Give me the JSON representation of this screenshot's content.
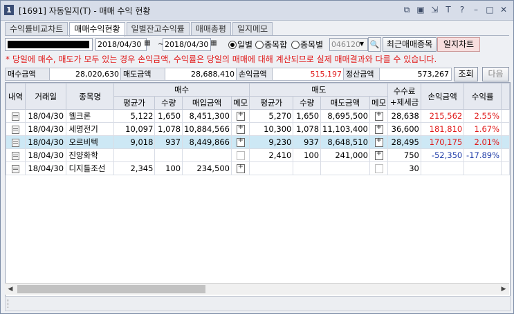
{
  "window": {
    "number": "1",
    "title": "[1691] 자동일지(T) - 매매 수익 현황"
  },
  "toolbar_icons": [
    "window-restore-icon",
    "window-split-icon",
    "arrow-icon",
    "font-icon",
    "help-icon",
    "minimize-icon",
    "maximize-icon",
    "close-icon"
  ],
  "tabs": [
    {
      "label": "수익률비교차트",
      "active": false
    },
    {
      "label": "매매수익현황",
      "active": true
    },
    {
      "label": "일별잔고수익률",
      "active": false
    },
    {
      "label": "매매총평",
      "active": false
    },
    {
      "label": "일지메모",
      "active": false
    }
  ],
  "filter": {
    "date_from": "2018/04/30",
    "date_to": "2018/04/30",
    "tilde": "~",
    "radios": [
      {
        "label": "일별",
        "selected": true
      },
      {
        "label": "종목합",
        "selected": false
      },
      {
        "label": "종목별",
        "selected": false
      }
    ],
    "stock_code": "046120",
    "recent_button": "최근매매종목",
    "chart_button": "일지차트"
  },
  "notice": "* 당일에 매수, 매도가 모두 있는 경우 손익금액, 수익률은 당일의 매매에 대해 계산되므로 실제 매매결과와 다를 수 있습니다.",
  "summary": {
    "buy_label": "매수금액",
    "buy_value": "28,020,630",
    "sell_label": "매도금액",
    "sell_value": "28,688,410",
    "pl_label": "손익금액",
    "pl_value": "515,197",
    "settle_label": "정산금액",
    "settle_value": "573,267",
    "query_button": "조회",
    "next_button": "다음"
  },
  "table": {
    "headers": {
      "detail": "내역",
      "date": "거래일",
      "name": "종목명",
      "buy_group": "매수",
      "sell_group": "매도",
      "avg_price": "평균가",
      "qty": "수량",
      "buy_amount": "매입금액",
      "memo": "메모",
      "sell_amount": "매도금액",
      "fee": "수수료",
      "fee2": "+제세금",
      "pl": "손익금액",
      "rate": "수익률"
    },
    "rows": [
      {
        "date": "18/04/30",
        "name": "웰크론",
        "buy_avg": "5,122",
        "buy_qty": "1,650",
        "buy_amt": "8,451,300",
        "buy_memo": "plus",
        "sell_avg": "5,270",
        "sell_qty": "1,650",
        "sell_amt": "8,695,500",
        "sell_memo": "plus",
        "fee": "28,638",
        "pl": "215,562",
        "rate": "2.55%",
        "color": "red",
        "selected": false
      },
      {
        "date": "18/04/30",
        "name": "세명전기",
        "buy_avg": "10,097",
        "buy_qty": "1,078",
        "buy_amt": "10,884,566",
        "buy_memo": "plus",
        "sell_avg": "10,300",
        "sell_qty": "1,078",
        "sell_amt": "11,103,400",
        "sell_memo": "plus",
        "fee": "36,600",
        "pl": "181,810",
        "rate": "1.67%",
        "color": "red",
        "selected": false
      },
      {
        "date": "18/04/30",
        "name": "오르비텍",
        "buy_avg": "9,018",
        "buy_qty": "937",
        "buy_amt": "8,449,866",
        "buy_memo": "plus",
        "sell_avg": "9,230",
        "sell_qty": "937",
        "sell_amt": "8,648,510",
        "sell_memo": "plus",
        "fee": "28,495",
        "pl": "170,175",
        "rate": "2.01%",
        "color": "red",
        "selected": true
      },
      {
        "date": "18/04/30",
        "name": "진양화학",
        "buy_avg": "",
        "buy_qty": "",
        "buy_amt": "",
        "buy_memo": "blank",
        "sell_avg": "2,410",
        "sell_qty": "100",
        "sell_amt": "241,000",
        "sell_memo": "plus",
        "fee": "750",
        "pl": "-52,350",
        "rate": "-17.89%",
        "color": "blue",
        "selected": false
      },
      {
        "date": "18/04/30",
        "name": "디지틀조선",
        "buy_avg": "2,345",
        "buy_qty": "100",
        "buy_amt": "234,500",
        "buy_memo": "plus",
        "sell_avg": "",
        "sell_qty": "",
        "sell_amt": "",
        "sell_memo": "blank",
        "fee": "30",
        "pl": "",
        "rate": "",
        "color": "red",
        "selected": false
      }
    ]
  }
}
